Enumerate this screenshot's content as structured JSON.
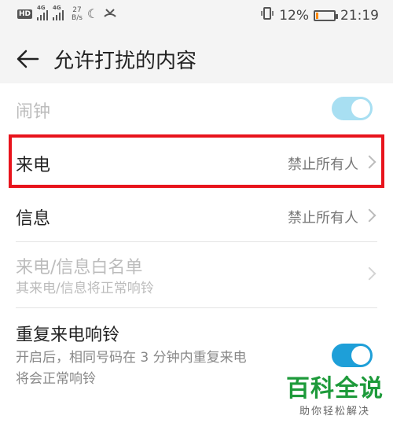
{
  "status_bar": {
    "hd": "HD",
    "signal1_label": "4G",
    "signal2_label": "4G",
    "net_speed_value": "27",
    "net_speed_unit": "B/s",
    "battery_percent": "12%",
    "battery_level": 0.12,
    "time": "21:19"
  },
  "header": {
    "title": "允许打扰的内容"
  },
  "items": {
    "alarm": {
      "label": "闹钟",
      "toggle_on": true
    },
    "calls": {
      "label": "来电",
      "value": "禁止所有人"
    },
    "messages": {
      "label": "信息",
      "value": "禁止所有人"
    },
    "whitelist": {
      "label": "来电/信息白名单",
      "subtitle": "其来电/信息将正常响铃"
    },
    "repeat_calls": {
      "label": "重复来电响铃",
      "subtitle_line1": "开启后，相同号码在 3 分钟内重复来电",
      "subtitle_line2": "将会正常响铃",
      "toggle_on": true
    }
  },
  "watermark": {
    "main": "百科全说",
    "sub": "助你轻松解决"
  },
  "colors": {
    "accent": "#1e9fd8",
    "highlight": "#e8141c",
    "watermark": "#1d9a3a",
    "battery_low": "#ff8a00"
  }
}
